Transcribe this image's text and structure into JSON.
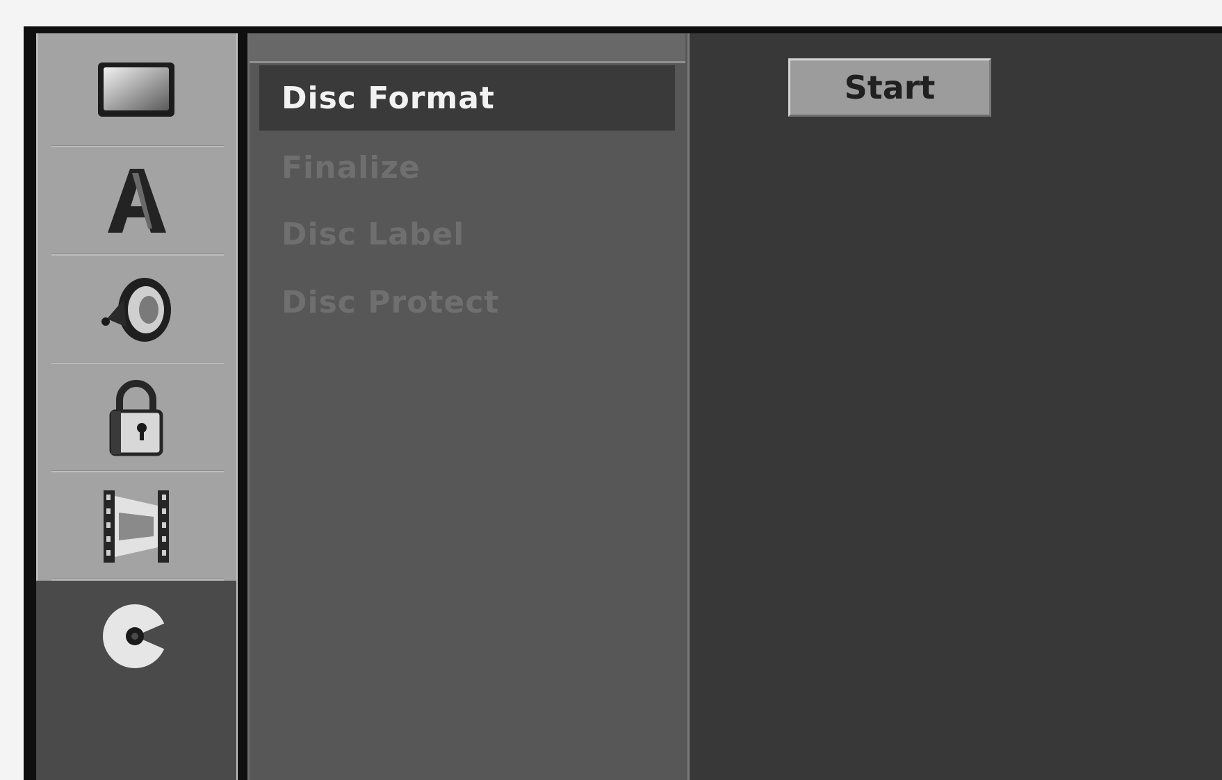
{
  "sidebar": {
    "items": [
      {
        "icon": "tv-screen-icon"
      },
      {
        "icon": "language-a-icon"
      },
      {
        "icon": "speaker-audio-icon"
      },
      {
        "icon": "padlock-icon"
      },
      {
        "icon": "film-strip-icon"
      },
      {
        "icon": "disc-icon",
        "active": true
      }
    ]
  },
  "menu": {
    "items": [
      {
        "label": "Disc Format",
        "selected": true
      },
      {
        "label": "Finalize"
      },
      {
        "label": "Disc Label"
      },
      {
        "label": "Disc Protect"
      }
    ]
  },
  "action": {
    "start_label": "Start"
  },
  "colors": {
    "sidebar_bg": "#a3a3a3",
    "menu_bg": "#575757",
    "selected_bg": "#3a3a3a",
    "right_bg": "#383838",
    "button_bg": "#9c9c9c"
  }
}
